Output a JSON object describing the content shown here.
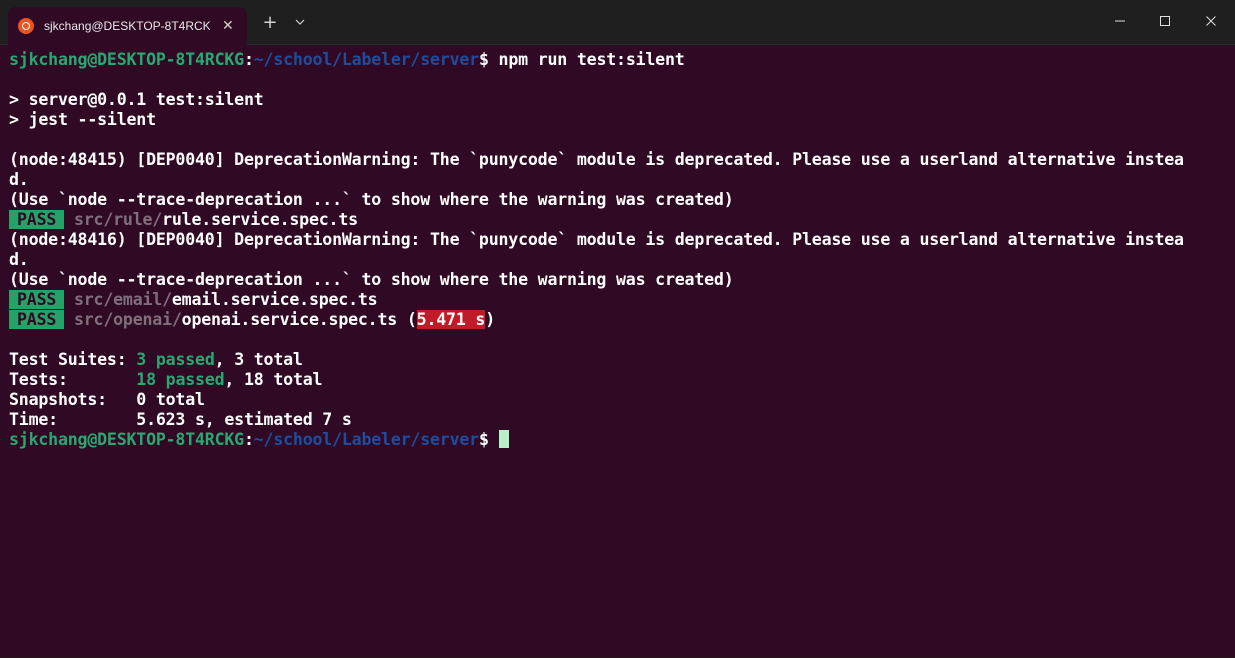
{
  "tab": {
    "title": "sjkchang@DESKTOP-8T4RCKG",
    "close": "✕"
  },
  "titlebar": {
    "new_tab": "+",
    "dropdown": "⌄"
  },
  "prompt": {
    "user_host": "sjkchang@DESKTOP-8T4RCKG",
    "colon": ":",
    "path": "~/school/Labeler/server",
    "dollar": "$"
  },
  "command": " npm run test:silent",
  "script_lines": [
    "> server@0.0.1 test:silent",
    "> jest --silent"
  ],
  "warning1": {
    "line1": "(node:48415) [DEP0040] DeprecationWarning: The `punycode` module is deprecated. Please use a userland alternative instea",
    "line2": "d.",
    "line3": "(Use `node --trace-deprecation ...` to show where the warning was created)"
  },
  "result1": {
    "badge": "PASS",
    "dir": "src/rule/",
    "file": "rule.service.spec.ts"
  },
  "warning2": {
    "line1": "(node:48416) [DEP0040] DeprecationWarning: The `punycode` module is deprecated. Please use a userland alternative instea",
    "line2": "d.",
    "line3": "(Use `node --trace-deprecation ...` to show where the warning was created)"
  },
  "result2": {
    "badge": "PASS",
    "dir": "src/email/",
    "file": "email.service.spec.ts"
  },
  "result3": {
    "badge": "PASS",
    "dir": "src/openai/",
    "file": "openai.service.spec.ts",
    "open": " (",
    "time": "5.471 s",
    "close": ")"
  },
  "summary": {
    "suites_label": "Test Suites: ",
    "suites_passed": "3 passed",
    "suites_total": ", 3 total",
    "tests_label": "Tests:       ",
    "tests_passed": "18 passed",
    "tests_total": ", 18 total",
    "snapshots": "Snapshots:   0 total",
    "time": "Time:        5.623 s, estimated 7 s"
  },
  "colors": {
    "background": "#300a24",
    "prompt_user": "#2aa872",
    "prompt_path": "#1e4d9e",
    "pass_badge": "#26a269",
    "slow_time": "#c01c28"
  }
}
